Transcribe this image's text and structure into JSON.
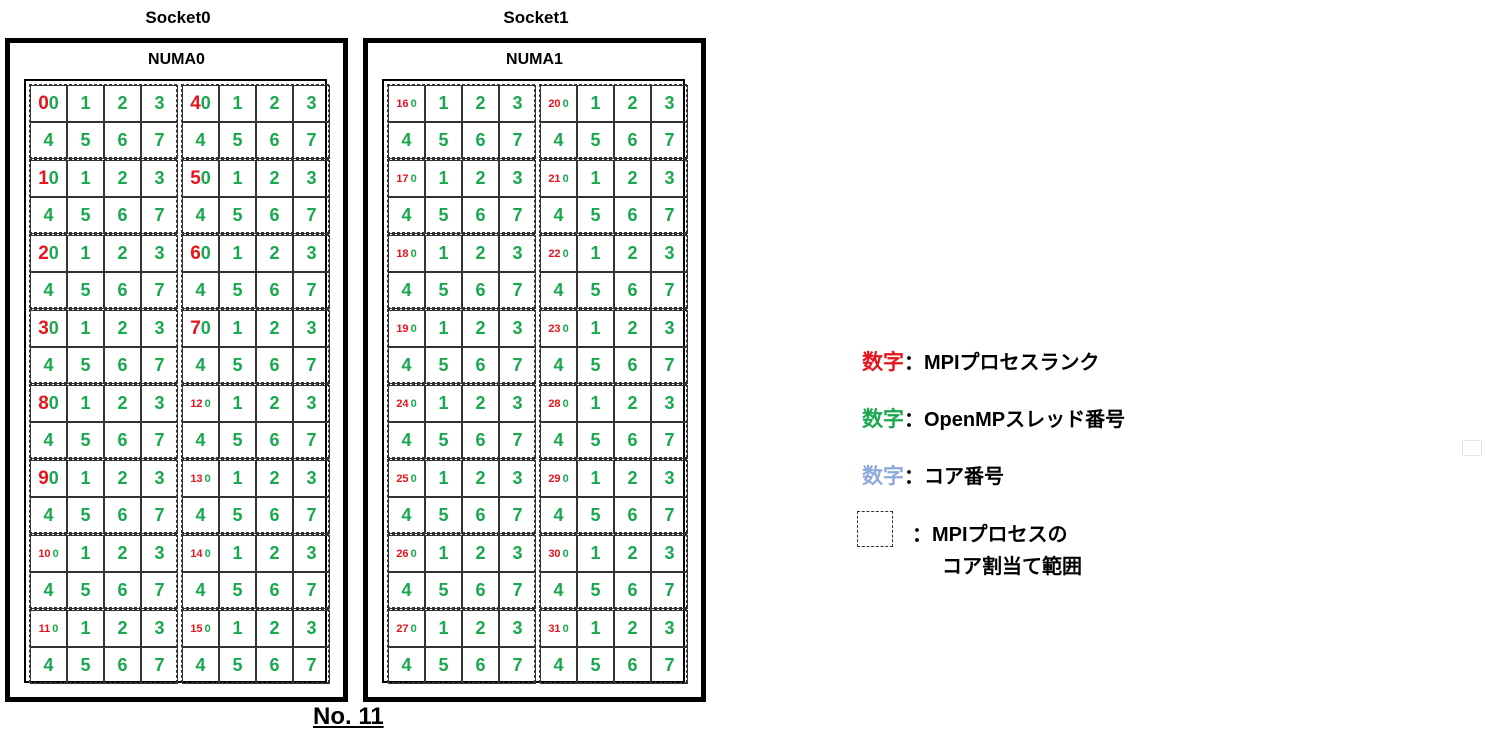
{
  "sockets": [
    {
      "label": "Socket0",
      "numa_label": "NUMA0",
      "left_ranks": [
        "0",
        "1",
        "2",
        "3",
        "8",
        "9",
        "10",
        "11"
      ],
      "right_ranks": [
        "4",
        "5",
        "6",
        "7",
        "12",
        "13",
        "14",
        "15"
      ]
    },
    {
      "label": "Socket1",
      "numa_label": "NUMA1",
      "left_ranks": [
        "16",
        "17",
        "18",
        "19",
        "24",
        "25",
        "26",
        "27"
      ],
      "right_ranks": [
        "20",
        "21",
        "22",
        "23",
        "28",
        "29",
        "30",
        "31"
      ]
    }
  ],
  "thread_rows": [
    [
      "0",
      "1",
      "2",
      "3"
    ],
    [
      "4",
      "5",
      "6",
      "7"
    ]
  ],
  "legend": {
    "rank": {
      "mark": "数字",
      "text": "：MPIプロセスランク",
      "color": "#e8141b"
    },
    "thread": {
      "mark": "数字",
      "text": "：OpenMPスレッド番号",
      "color": "#1aa84f"
    },
    "core": {
      "mark": "数字",
      "text": "：コア番号",
      "color": "#8faadc"
    },
    "range_line1": "：MPIプロセスの",
    "range_line2": "コア割当て範囲"
  },
  "footer": "No. 11"
}
